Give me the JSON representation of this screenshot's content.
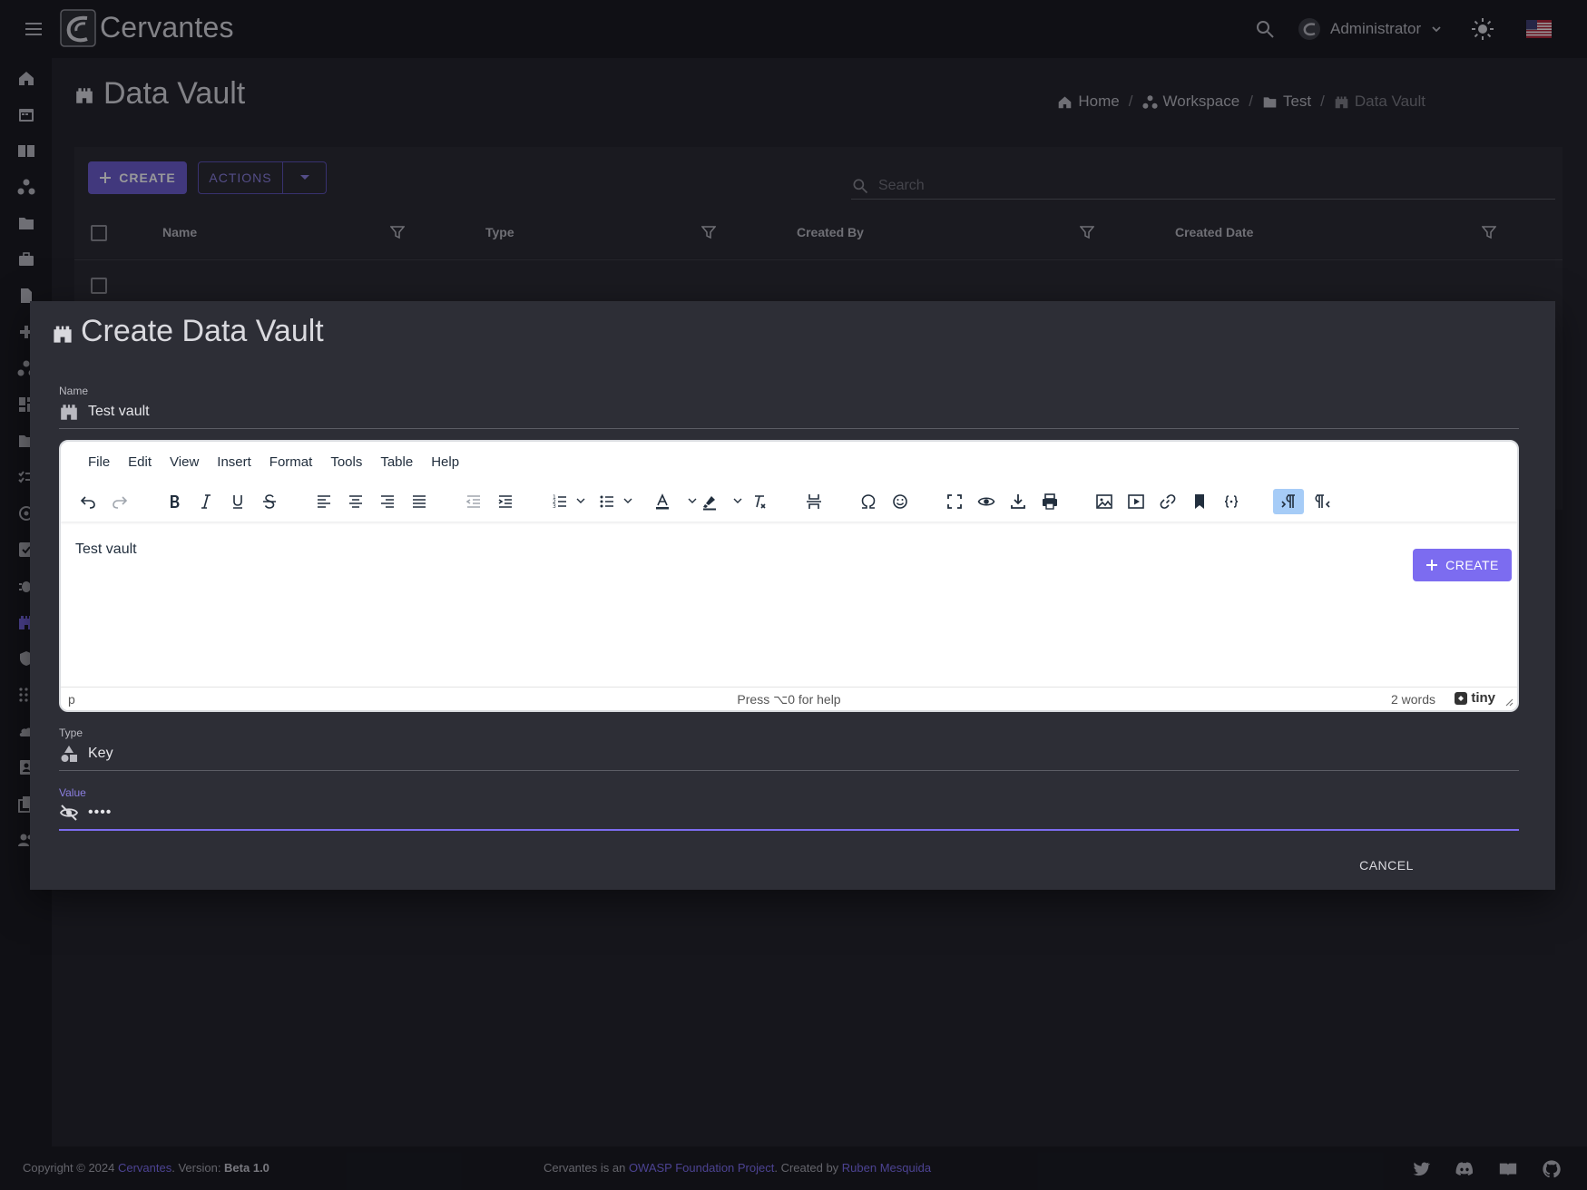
{
  "app": {
    "name": "Cervantes",
    "user": "Administrator"
  },
  "page": {
    "title": "Data Vault",
    "breadcrumb": [
      {
        "label": "Home",
        "icon": "home-icon"
      },
      {
        "label": "Workspace",
        "icon": "workspace-icon"
      },
      {
        "label": "Test",
        "icon": "folder-icon"
      },
      {
        "label": "Data Vault",
        "icon": "vault-icon"
      }
    ],
    "toolbar": {
      "create_label": "CREATE",
      "actions_label": "ACTIONS",
      "search_placeholder": "Search"
    },
    "table": {
      "columns": [
        "Name",
        "Type",
        "Created By",
        "Created Date"
      ]
    }
  },
  "dialog": {
    "title": "Create Data Vault",
    "name_label": "Name",
    "name_value": "Test vault",
    "editor": {
      "menu": [
        "File",
        "Edit",
        "View",
        "Insert",
        "Format",
        "Tools",
        "Table",
        "Help"
      ],
      "content": "Test vault",
      "status_path": "p",
      "status_help": "Press ⌥0 for help",
      "status_words": "2 words",
      "brand": "tiny"
    },
    "type_label": "Type",
    "type_value": "Key",
    "value_label": "Value",
    "value_masked": "••••",
    "cancel_label": "CANCEL",
    "create_label": "CREATE"
  },
  "footer": {
    "copyright_prefix": "Copyright © 2024 ",
    "copyright_link": "Cervantes",
    "version_prefix": ". Version: ",
    "version": "Beta 1.0",
    "owasp_prefix": "Cervantes is an ",
    "owasp_link": "OWASP Foundation Project",
    "created_prefix": ". Created by ",
    "author_link": "Ruben Mesquida"
  },
  "colors": {
    "accent": "#7c6cf0",
    "background": "#1f2026",
    "bar": "#15161b",
    "dialog": "#2d2e36"
  }
}
